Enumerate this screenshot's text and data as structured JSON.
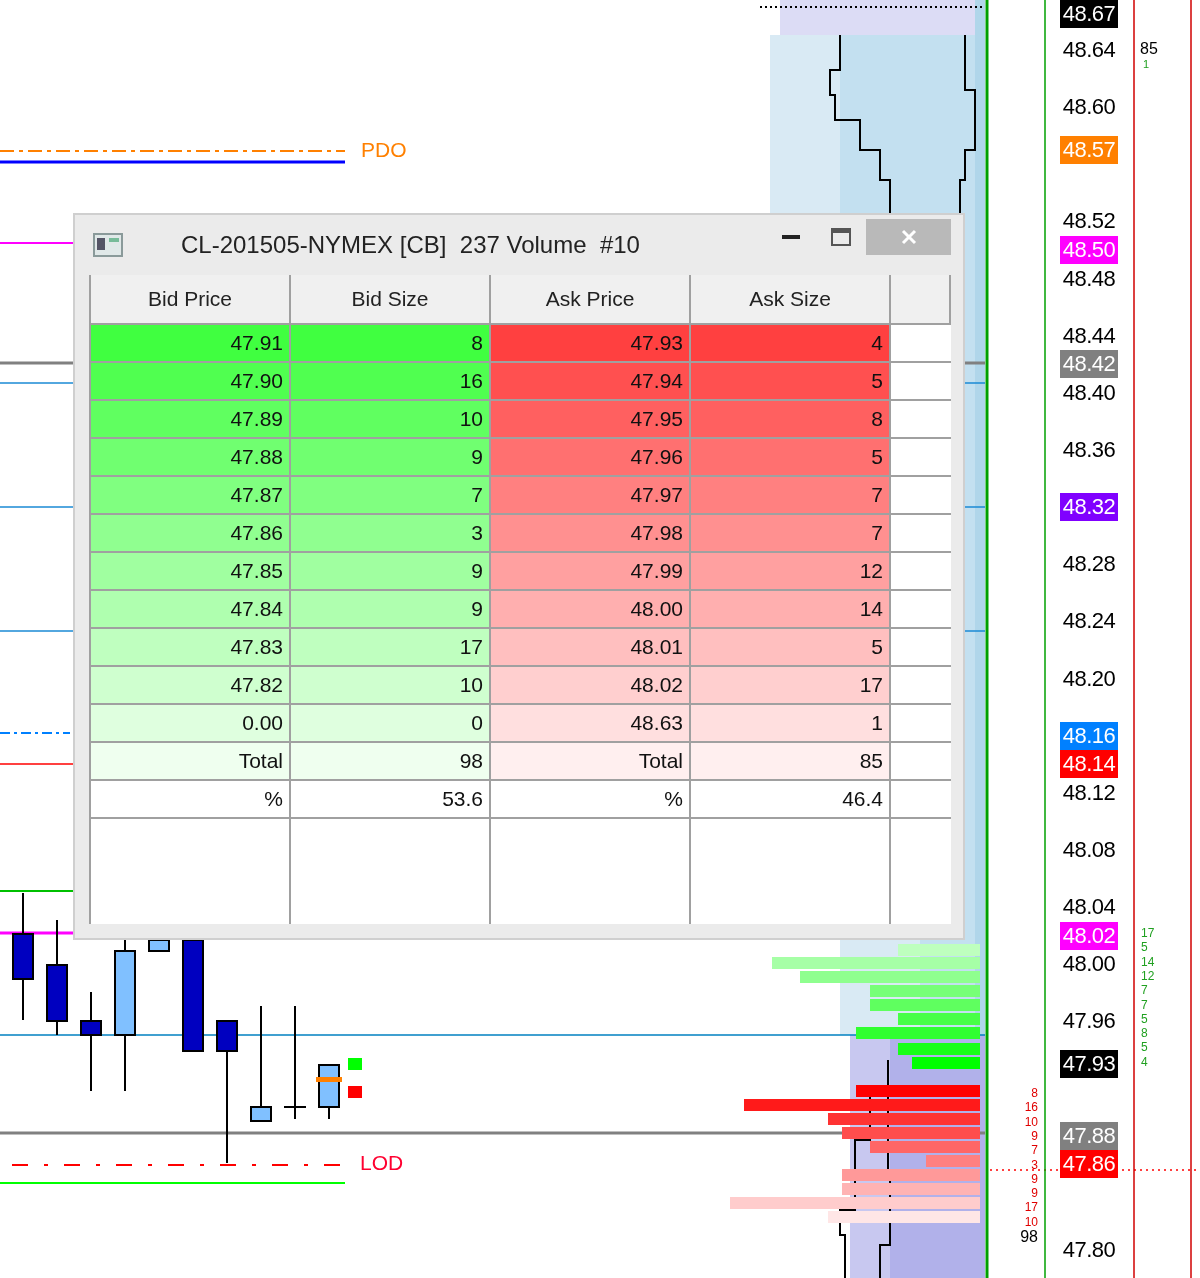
{
  "chart": {
    "level_labels": [
      {
        "text": "PDO",
        "kind": "prior-open"
      },
      {
        "text": "LOD",
        "kind": "low-of-day"
      }
    ],
    "price_axis": [
      {
        "text": "48.67",
        "kind": "badge",
        "color": "#000000"
      },
      {
        "text": "48.64",
        "kind": "plain"
      },
      {
        "text": "48.60",
        "kind": "plain"
      },
      {
        "text": "48.57",
        "kind": "badge",
        "color": "#ff8000"
      },
      {
        "text": "48.52",
        "kind": "plain"
      },
      {
        "text": "48.50",
        "kind": "badge",
        "color": "#ff00ff"
      },
      {
        "text": "48.48",
        "kind": "plain"
      },
      {
        "text": "48.44",
        "kind": "plain"
      },
      {
        "text": "48.42",
        "kind": "badge",
        "color": "#808080"
      },
      {
        "text": "48.40",
        "kind": "plain"
      },
      {
        "text": "48.36",
        "kind": "plain"
      },
      {
        "text": "48.32",
        "kind": "badge",
        "color": "#8000ff"
      },
      {
        "text": "48.28",
        "kind": "plain"
      },
      {
        "text": "48.24",
        "kind": "plain"
      },
      {
        "text": "48.20",
        "kind": "plain"
      },
      {
        "text": "48.16",
        "kind": "badge",
        "color": "#0080ff"
      },
      {
        "text": "48.14",
        "kind": "badge",
        "color": "#ff0000"
      },
      {
        "text": "48.12",
        "kind": "plain"
      },
      {
        "text": "48.08",
        "kind": "plain"
      },
      {
        "text": "48.04",
        "kind": "plain"
      },
      {
        "text": "48.02",
        "kind": "badge",
        "color": "#ff00ff"
      },
      {
        "text": "48.00",
        "kind": "plain"
      },
      {
        "text": "47.96",
        "kind": "plain"
      },
      {
        "text": "47.93",
        "kind": "badge",
        "color": "#000000"
      },
      {
        "text": "47.88",
        "kind": "badge",
        "color": "#808080"
      },
      {
        "text": "47.86",
        "kind": "badge",
        "color": "#ff0000"
      },
      {
        "text": "47.80",
        "kind": "plain"
      }
    ],
    "bid_size_ladder": [
      "8",
      "16",
      "10",
      "9",
      "7",
      "3",
      "9",
      "9",
      "17",
      "10"
    ],
    "bid_total": "98",
    "ask_size_ladder": [
      "17",
      "5",
      "14",
      "12",
      "7",
      "7",
      "5",
      "8",
      "5",
      "4"
    ],
    "ask_total": "85",
    "ask_top_size": "1"
  },
  "window": {
    "title": "CL-201505-NYMEX [CB]  237 Volume  #10"
  },
  "table": {
    "columns": [
      "Bid Price",
      "Bid Size",
      "Ask Price",
      "Ask Size"
    ],
    "rows": [
      {
        "cells": [
          "47.91",
          "8",
          "47.93",
          "4"
        ]
      },
      {
        "cells": [
          "47.90",
          "16",
          "47.94",
          "5"
        ]
      },
      {
        "cells": [
          "47.89",
          "10",
          "47.95",
          "8"
        ]
      },
      {
        "cells": [
          "47.88",
          "9",
          "47.96",
          "5"
        ]
      },
      {
        "cells": [
          "47.87",
          "7",
          "47.97",
          "7"
        ]
      },
      {
        "cells": [
          "47.86",
          "3",
          "47.98",
          "7"
        ]
      },
      {
        "cells": [
          "47.85",
          "9",
          "47.99",
          "12"
        ]
      },
      {
        "cells": [
          "47.84",
          "9",
          "48.00",
          "14"
        ]
      },
      {
        "cells": [
          "47.83",
          "17",
          "48.01",
          "5"
        ]
      },
      {
        "cells": [
          "47.82",
          "10",
          "48.02",
          "17"
        ]
      },
      {
        "cells": [
          "0.00",
          "0",
          "48.63",
          "1"
        ]
      },
      {
        "cells": [
          "Total",
          "98",
          "Total",
          "85"
        ]
      },
      {
        "cells": [
          "%",
          "53.6",
          "%",
          "46.4"
        ]
      }
    ]
  }
}
